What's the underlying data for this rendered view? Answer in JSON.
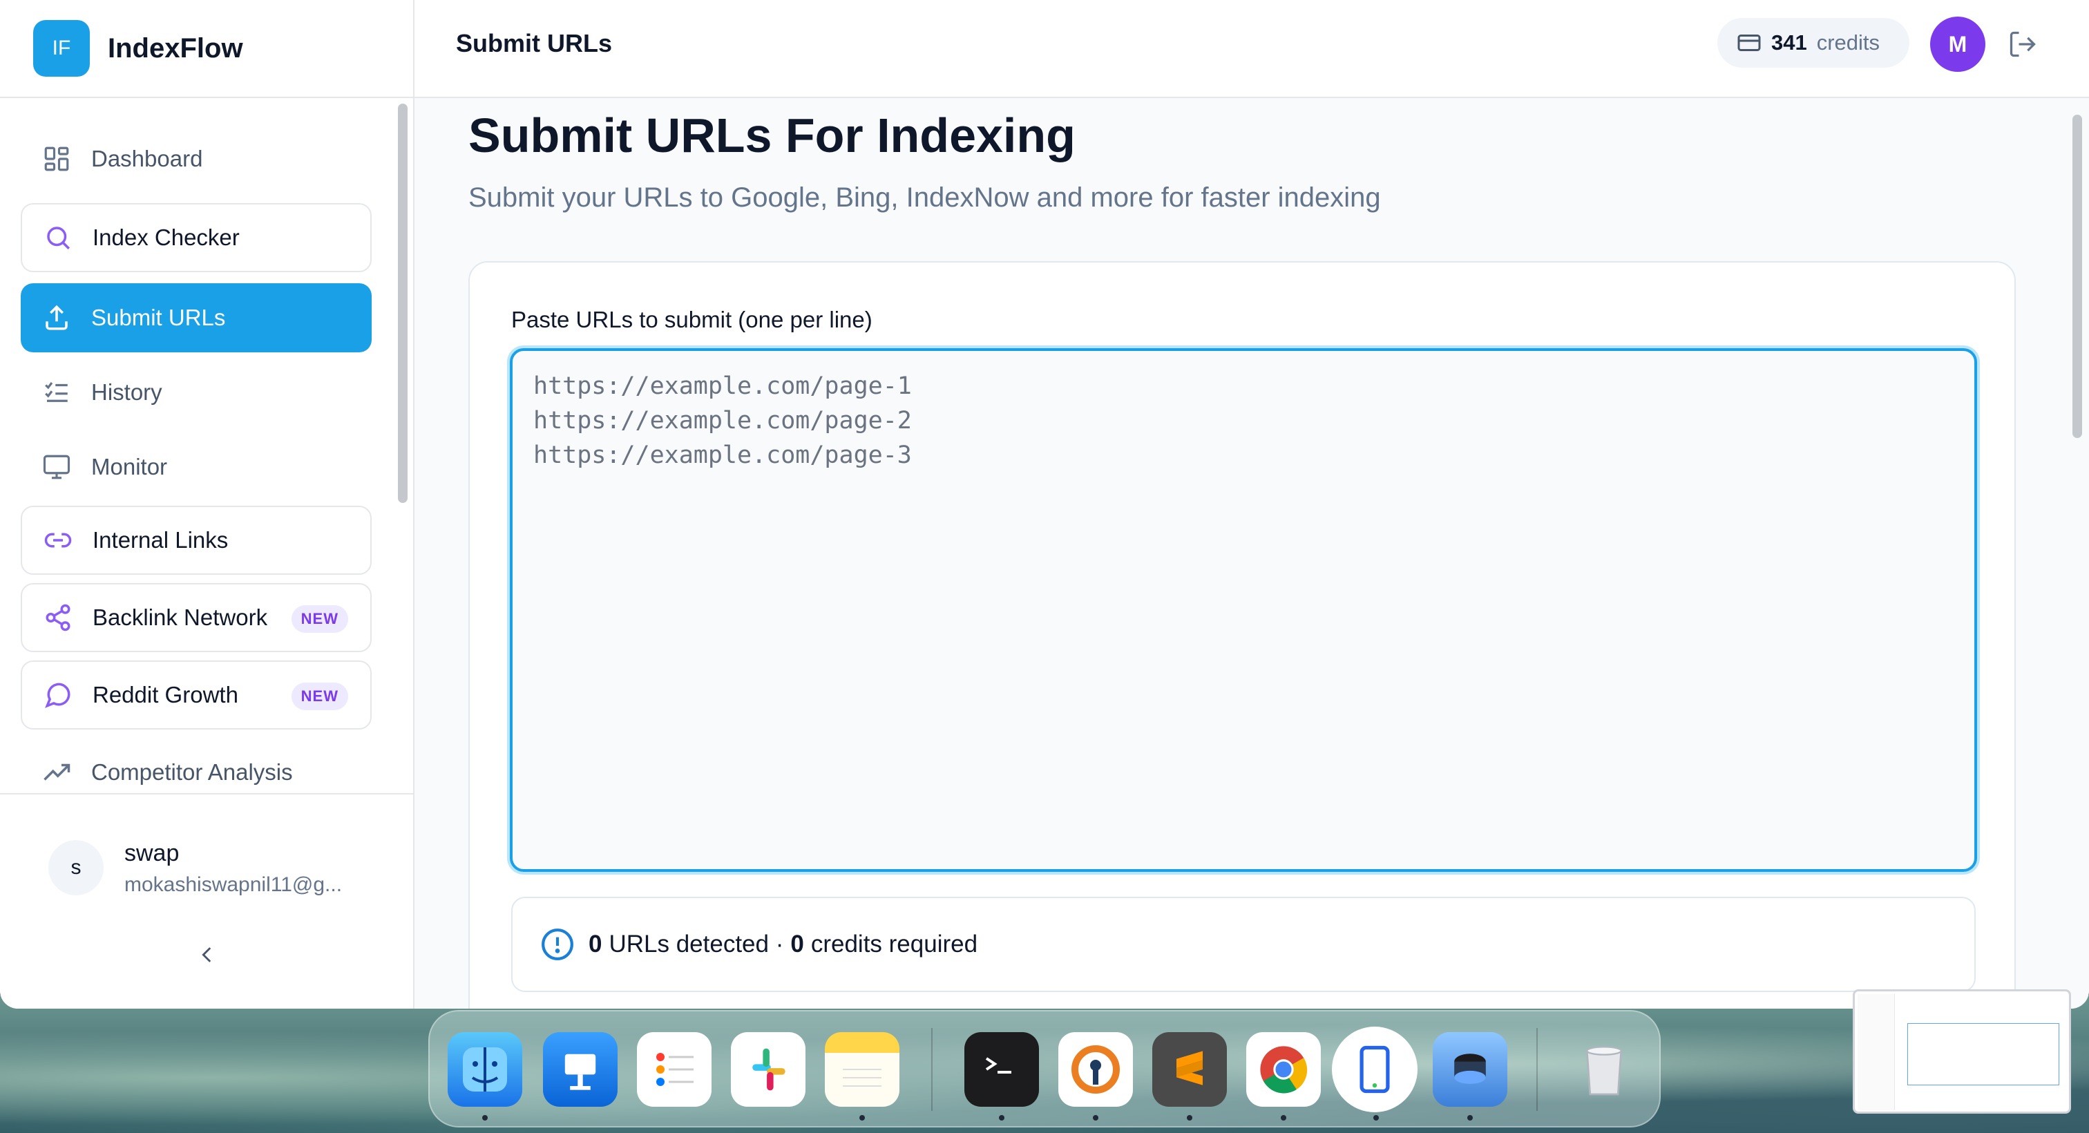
{
  "app": {
    "logo": "IF",
    "name": "IndexFlow"
  },
  "header": {
    "title": "Submit URLs",
    "credits_value": "341",
    "credits_label": "credits",
    "avatar_initial": "M"
  },
  "sidebar": {
    "items": [
      {
        "label": "Dashboard",
        "icon": "dashboard-icon"
      },
      {
        "label": "Index Checker",
        "icon": "search-icon"
      },
      {
        "label": "Submit URLs",
        "icon": "upload-icon"
      },
      {
        "label": "History",
        "icon": "list-check-icon"
      },
      {
        "label": "Monitor",
        "icon": "monitor-icon"
      },
      {
        "label": "Internal Links",
        "icon": "link-icon"
      },
      {
        "label": "Backlink Network",
        "icon": "share-icon",
        "badge": "NEW"
      },
      {
        "label": "Reddit Growth",
        "icon": "chat-icon",
        "badge": "NEW"
      },
      {
        "label": "Competitor Analysis",
        "icon": "trending-up-icon"
      }
    ],
    "user": {
      "initial": "s",
      "name": "swap",
      "email": "mokashiswapnil11@g..."
    }
  },
  "main": {
    "title": "Submit URLs For Indexing",
    "subtitle": "Submit your URLs to Google, Bing, IndexNow and more for faster indexing",
    "textarea_label": "Paste URLs to submit (one per line)",
    "textarea_placeholder": "https://example.com/page-1\nhttps://example.com/page-2\nhttps://example.com/page-3",
    "detect": {
      "urls_count": "0",
      "urls_text": "URLs detected ·",
      "credits_count": "0",
      "credits_text": "credits required"
    }
  },
  "colors": {
    "accent": "#1aa0e6",
    "badge_purple": "#7c3aed",
    "avatar_purple": "#7c3aed"
  },
  "dock": {
    "apps": [
      "finder-icon",
      "keynote-icon",
      "reminders-icon",
      "slack-icon",
      "notes-icon",
      "terminal-icon",
      "openvpn-icon",
      "sublime-icon",
      "chrome-icon",
      "simulator-icon",
      "spotlight-icon",
      "trash-icon"
    ]
  }
}
